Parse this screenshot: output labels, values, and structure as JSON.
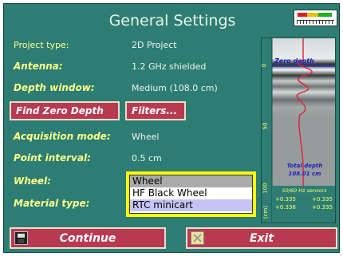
{
  "window": {
    "title": "General Settings"
  },
  "fields": [
    {
      "label": "Project type:",
      "value": "2D Project"
    },
    {
      "label": "Antenna:",
      "value": "1.2 GHz shielded"
    },
    {
      "label": "Depth window:",
      "value": "Medium (108.0 cm)"
    },
    {
      "label": "Acquisition mode:",
      "value": "Wheel"
    },
    {
      "label": "Point interval:",
      "value": "0.5 cm"
    },
    {
      "label": "Wheel:"
    },
    {
      "label": "Material type:"
    }
  ],
  "buttons": {
    "find_zero_depth": "Find Zero Depth",
    "filters": "Filters...",
    "continue": "Continue",
    "exit": "Exit"
  },
  "wheel_list": {
    "options": [
      "Wheel",
      "HF Black Wheel",
      "RTC minicart"
    ],
    "selected": "Wheel"
  },
  "radar": {
    "zero_depth_label": "Zero depth",
    "total_depth_label": "Total depth",
    "total_depth_value": "108.01 cm",
    "axis_ticks": [
      "0",
      "50",
      "100"
    ],
    "axis_unit": "(cm)",
    "sensors_label": "50/60 Hz sensors",
    "sensor_values": [
      "+0.335",
      "+0.335",
      "+0.336",
      "+0.335"
    ]
  },
  "colors": {
    "background": "#2d7d74",
    "accent": "#b83a52",
    "label": "#ffff88",
    "highlight": "#ffff00"
  }
}
